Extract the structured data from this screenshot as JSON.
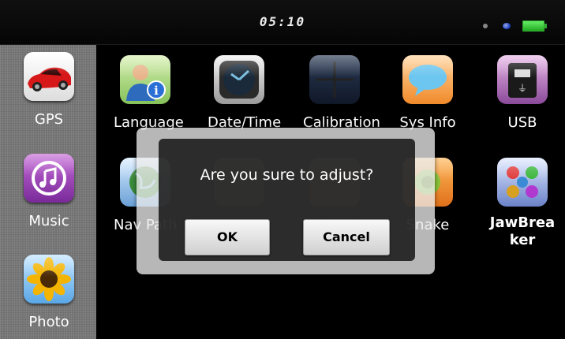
{
  "status_bar": {
    "time": "05:10",
    "icons": [
      "status-dot-icon",
      "bluetooth-indicator-icon",
      "battery-icon"
    ]
  },
  "sidebar": {
    "items": [
      {
        "label": "GPS",
        "icon": "car-icon"
      },
      {
        "label": "Music",
        "icon": "music-note-icon"
      },
      {
        "label": "Photo",
        "icon": "sunflower-icon"
      }
    ]
  },
  "grid": {
    "row1": [
      {
        "label": "Language",
        "icon": "person-info-icon"
      },
      {
        "label": "Date/Time",
        "icon": "clock-icon"
      },
      {
        "label": "Calibration",
        "icon": "crosshair-icon"
      },
      {
        "label": "Sys Info",
        "icon": "speech-bubble-icon"
      },
      {
        "label": "USB",
        "icon": "usb-drive-icon"
      }
    ],
    "row2": [
      {
        "label": "Nav Path",
        "icon": "globe-icon"
      },
      {
        "label": "",
        "icon": "puzzle-icon"
      },
      {
        "label": "",
        "icon": "game-icon"
      },
      {
        "label": "Snake",
        "icon": "snake-icon"
      },
      {
        "label": "JawBreaker",
        "icon": "jawbreaker-icon"
      }
    ]
  },
  "dialog": {
    "message": "Are you sure to adjust?",
    "ok_label": "OK",
    "cancel_label": "Cancel"
  },
  "colors": {
    "background": "#000000",
    "sidebar": "#777777",
    "button": "#e8e8e8"
  }
}
